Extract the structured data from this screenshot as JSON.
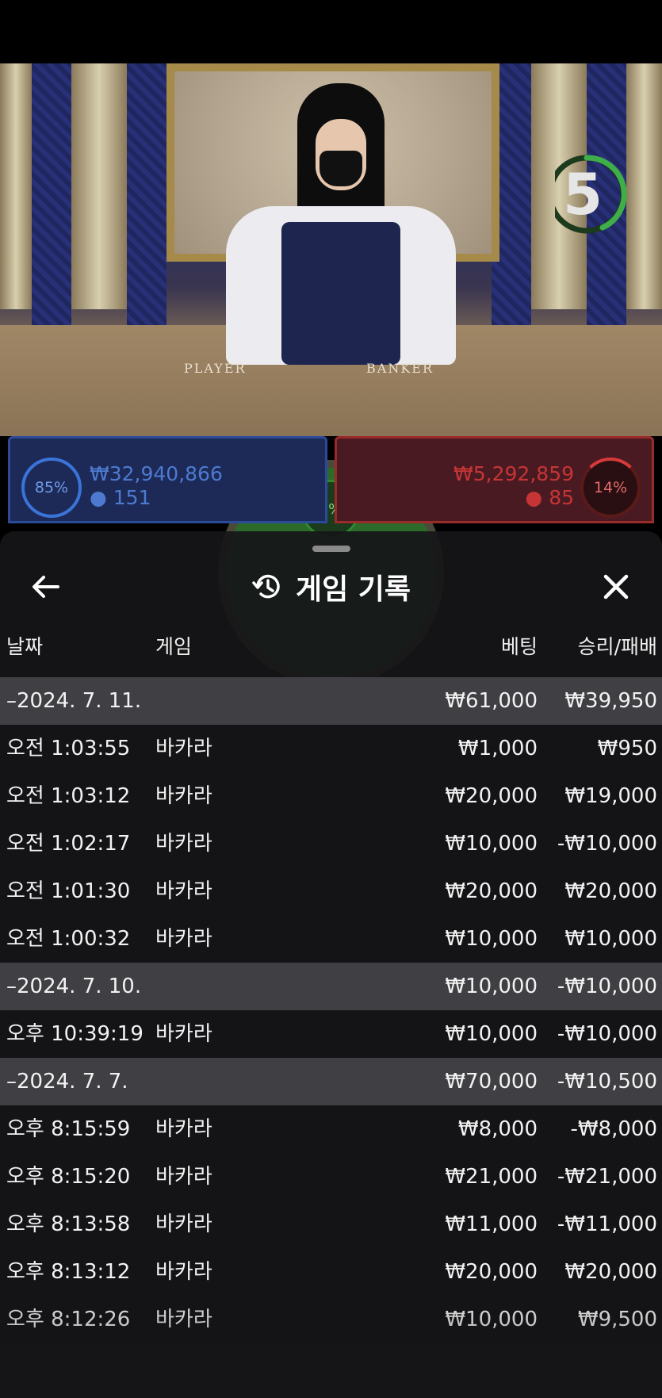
{
  "timer": {
    "value": "5"
  },
  "table_labels": {
    "player": "PLAYER",
    "banker": "BANKER"
  },
  "bet_stats": {
    "player": {
      "percent": "85%",
      "amount": "₩32,940,866",
      "count": "151",
      "percent_value": 85,
      "color": "#3a74d8"
    },
    "banker": {
      "percent": "14%",
      "amount": "₩5,292,859",
      "count": "85",
      "percent_value": 14,
      "color": "#d83a3a"
    },
    "tie": {
      "percent": "1%",
      "percent_value": 1,
      "color": "#2f8a2f"
    }
  },
  "sheet": {
    "title": "게임 기록",
    "icons": {
      "back": "arrow-left-icon",
      "history": "history-icon",
      "close": "close-icon"
    },
    "columns": {
      "date": "날짜",
      "game": "게임",
      "bet": "베팅",
      "result": "승리/패배"
    },
    "rows": [
      {
        "type": "group",
        "date": "–2024. 7. 11.",
        "game": "",
        "bet": "₩61,000",
        "result": "₩39,950"
      },
      {
        "type": "entry",
        "date": "오전 1:03:55",
        "game": "바카라",
        "bet": "₩1,000",
        "result": "₩950"
      },
      {
        "type": "entry",
        "date": "오전 1:03:12",
        "game": "바카라",
        "bet": "₩20,000",
        "result": "₩19,000"
      },
      {
        "type": "entry",
        "date": "오전 1:02:17",
        "game": "바카라",
        "bet": "₩10,000",
        "result": "-₩10,000"
      },
      {
        "type": "entry",
        "date": "오전 1:01:30",
        "game": "바카라",
        "bet": "₩20,000",
        "result": "₩20,000"
      },
      {
        "type": "entry",
        "date": "오전 1:00:32",
        "game": "바카라",
        "bet": "₩10,000",
        "result": "₩10,000"
      },
      {
        "type": "group",
        "date": "–2024. 7. 10.",
        "game": "",
        "bet": "₩10,000",
        "result": "-₩10,000"
      },
      {
        "type": "entry",
        "date": "오후 10:39:19",
        "game": "바카라",
        "bet": "₩10,000",
        "result": "-₩10,000"
      },
      {
        "type": "group",
        "date": "–2024. 7. 7.",
        "game": "",
        "bet": "₩70,000",
        "result": "-₩10,500"
      },
      {
        "type": "entry",
        "date": "오후 8:15:59",
        "game": "바카라",
        "bet": "₩8,000",
        "result": "-₩8,000"
      },
      {
        "type": "entry",
        "date": "오후 8:15:20",
        "game": "바카라",
        "bet": "₩21,000",
        "result": "-₩21,000"
      },
      {
        "type": "entry",
        "date": "오후 8:13:58",
        "game": "바카라",
        "bet": "₩11,000",
        "result": "-₩11,000"
      },
      {
        "type": "entry",
        "date": "오후 8:13:12",
        "game": "바카라",
        "bet": "₩20,000",
        "result": "₩20,000"
      },
      {
        "type": "entry",
        "date": "오후 8:12:26",
        "game": "바카라",
        "bet": "₩10,000",
        "result": "₩9,500"
      }
    ]
  }
}
